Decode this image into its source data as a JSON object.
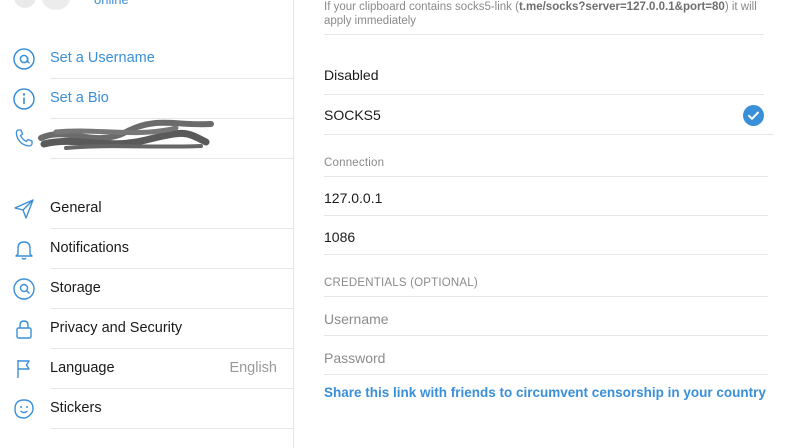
{
  "profile": {
    "status": "online"
  },
  "account_items": [
    {
      "label": "Set a Username",
      "icon": "at-icon"
    },
    {
      "label": "Set a Bio",
      "icon": "info-icon"
    },
    {
      "label": "",
      "icon": "phone-icon"
    }
  ],
  "settings_items": [
    {
      "label": "General",
      "icon": "paper-plane-icon"
    },
    {
      "label": "Notifications",
      "icon": "bell-icon"
    },
    {
      "label": "Storage",
      "icon": "storage-icon"
    },
    {
      "label": "Privacy and Security",
      "icon": "lock-icon"
    },
    {
      "label": "Language",
      "value": "English",
      "icon": "flag-icon"
    },
    {
      "label": "Stickers",
      "icon": "sticker-icon"
    }
  ],
  "proxy": {
    "hint_prefix": "If your clipboard contains socks5-link (",
    "hint_link": "t.me/socks?server=127.0.0.1&port=80",
    "hint_suffix": ") it will apply immediately",
    "options": [
      {
        "label": "Disabled",
        "selected": false
      },
      {
        "label": "SOCKS5",
        "selected": true
      }
    ],
    "connection_header": "Connection",
    "server": "127.0.0.1",
    "port": "1086",
    "credentials_header": "CREDENTIALS (OPTIONAL)",
    "username_placeholder": "Username",
    "password_placeholder": "Password",
    "share_link": "Share this link with friends to circumvent censorship in your country"
  },
  "colors": {
    "accent": "#3a8fd9",
    "separator": "#e6e6e6",
    "muted": "#9a9a9a"
  }
}
